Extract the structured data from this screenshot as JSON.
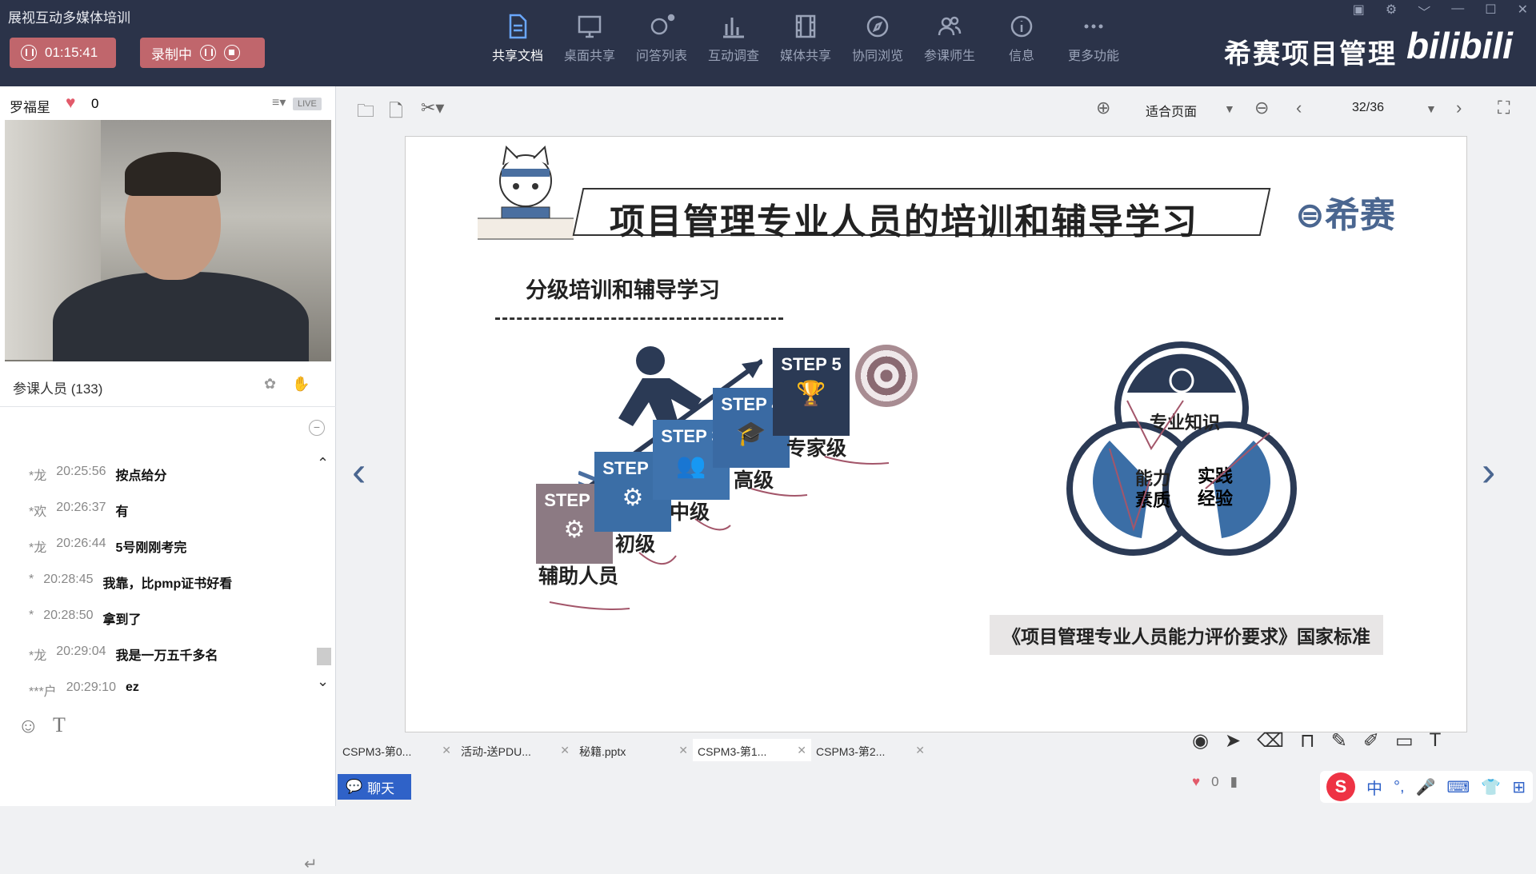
{
  "window": {
    "title": "展视互动多媒体培训",
    "controls": [
      "▣",
      "⚙",
      "﹀",
      "—",
      "☐",
      "✕"
    ]
  },
  "session": {
    "timer": "01:15:41",
    "recording_label": "录制中"
  },
  "toolbar": {
    "items": [
      {
        "label": "共享文档",
        "icon": "document-icon",
        "active": true
      },
      {
        "label": "桌面共享",
        "icon": "monitor-icon",
        "active": false
      },
      {
        "label": "问答列表",
        "icon": "qa-icon",
        "active": false
      },
      {
        "label": "互动调查",
        "icon": "bar-chart-icon",
        "active": false
      },
      {
        "label": "媒体共享",
        "icon": "film-icon",
        "active": false
      },
      {
        "label": "协同浏览",
        "icon": "compass-icon",
        "active": false
      },
      {
        "label": "参课师生",
        "icon": "users-icon",
        "active": false
      },
      {
        "label": "信息",
        "icon": "info-icon",
        "active": false
      },
      {
        "label": "更多功能",
        "icon": "more-icon",
        "active": false
      }
    ]
  },
  "brand": {
    "name": "希赛项目管理",
    "site": "bilibili"
  },
  "presenter": {
    "name": "罗福星",
    "likes": "0",
    "live_badge": "LIVE"
  },
  "attendees": {
    "label": "参课人员 (133)"
  },
  "chat": {
    "messages": [
      {
        "user": "*龙",
        "time": "20:25:56",
        "text": "按点给分"
      },
      {
        "user": "*欢",
        "time": "20:26:37",
        "text": "有"
      },
      {
        "user": "*龙",
        "time": "20:26:44",
        "text": "5号刚刚考完"
      },
      {
        "user": "*",
        "time": "20:28:45",
        "text": "我靠，比pmp证书好看"
      },
      {
        "user": "*",
        "time": "20:28:50",
        "text": "拿到了"
      },
      {
        "user": "*龙",
        "time": "20:29:04",
        "text": "我是一万五千多名"
      },
      {
        "user": "***户",
        "time": "20:29:10",
        "text": "ez"
      }
    ],
    "chat_button": "聊天"
  },
  "viewer": {
    "fit_label": "适合页面",
    "page": "32/36"
  },
  "slide": {
    "title": "项目管理专业人员的培训和辅导学习",
    "logo_text": "希赛",
    "subtitle": "分级培训和辅导学习",
    "steps": [
      {
        "label": "STEP 1",
        "level": "辅助人员",
        "color": "#8c7a83"
      },
      {
        "label": "STEP 2",
        "level": "初级",
        "color": "#3b6ea6"
      },
      {
        "label": "STEP 3",
        "level": "中级",
        "color": "#3f73ad"
      },
      {
        "label": "STEP 4",
        "level": "高级",
        "color": "#3a6aa3"
      },
      {
        "label": "STEP 5",
        "level": "专家级",
        "color": "#2b3a55"
      }
    ],
    "venn": {
      "top": "专业知识",
      "left_line1": "能力",
      "left_line2": "素质",
      "right_line1": "实践",
      "right_line2": "经验"
    },
    "standard": "《项目管理专业人员能力评价要求》国家标准"
  },
  "doc_tabs": [
    {
      "label": "CSPM3-第0..."
    },
    {
      "label": "活动-送PDU..."
    },
    {
      "label": "秘籍.pptx"
    },
    {
      "label": "CSPM3-第1..."
    },
    {
      "label": "CSPM3-第2..."
    }
  ],
  "tray": {
    "likes": "0"
  },
  "ime": {
    "logo": "S",
    "mode": "中"
  }
}
